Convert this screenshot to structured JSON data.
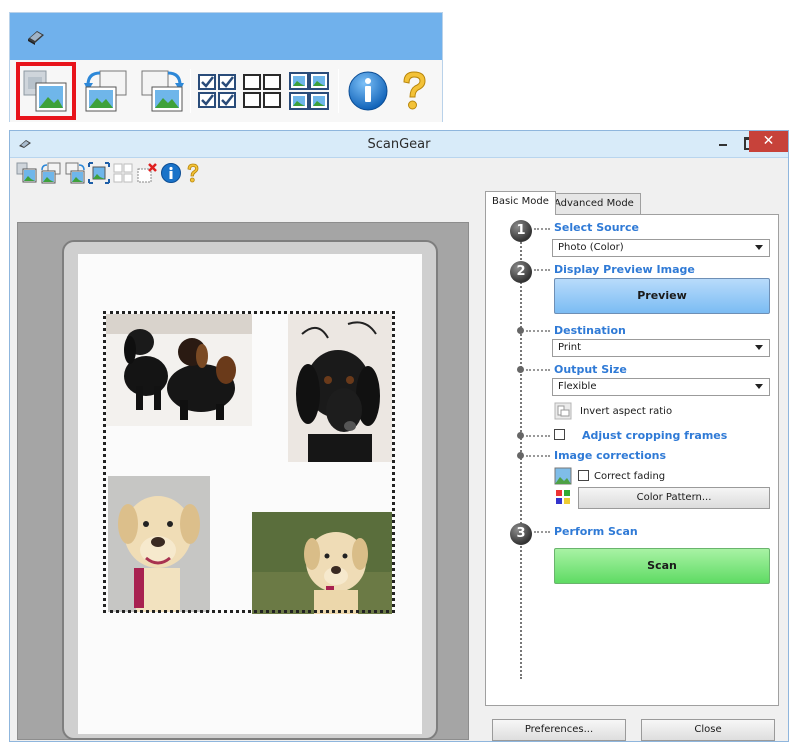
{
  "zoom_toolbar": {
    "title_icon": "scanner-icon",
    "buttons": [
      {
        "name": "auto-crop-icon",
        "highlighted": true
      },
      {
        "name": "rotate-left-icon"
      },
      {
        "name": "rotate-right-icon"
      },
      {
        "name": "select-all-frames-icon"
      },
      {
        "name": "multiple-crop-icon"
      },
      {
        "name": "info-icon"
      },
      {
        "name": "help-icon"
      }
    ],
    "highlight_color": "#e8141b"
  },
  "window": {
    "title": "ScanGear",
    "controls": {
      "close": "✕"
    }
  },
  "toolbar": {
    "buttons": [
      "auto-crop-icon",
      "rotate-left-icon",
      "rotate-right-icon",
      "auto-crop-all-icon",
      "select-all-frames-icon",
      "remove-frame-icon",
      "info-icon",
      "help-icon"
    ]
  },
  "tabs": [
    {
      "label": "Basic Mode",
      "active": true
    },
    {
      "label": "Advanced Mode",
      "active": false
    }
  ],
  "basic_mode": {
    "step1": {
      "number": "1",
      "label": "Select Source",
      "value": "Photo (Color)"
    },
    "step2": {
      "number": "2",
      "label": "Display Preview Image",
      "button": "Preview"
    },
    "destination": {
      "label": "Destination",
      "value": "Print"
    },
    "output_size": {
      "label": "Output Size",
      "value": "Flexible"
    },
    "invert_aspect_ratio": "Invert aspect ratio",
    "adjust_cropping_frames": {
      "label": "Adjust cropping frames",
      "checked": false
    },
    "image_corrections": {
      "label": "Image corrections",
      "correct_fading": "Correct fading",
      "correct_fading_checked": false,
      "color_pattern": "Color Pattern..."
    },
    "step3": {
      "number": "3",
      "label": "Perform Scan",
      "button": "Scan"
    }
  },
  "footer": {
    "preferences": "Preferences...",
    "close": "Close"
  },
  "colors": {
    "accent_label": "#2f7ad6",
    "preview_button": "#7bbcf3",
    "scan_button": "#5fdb64",
    "close_button": "#c7423a"
  }
}
